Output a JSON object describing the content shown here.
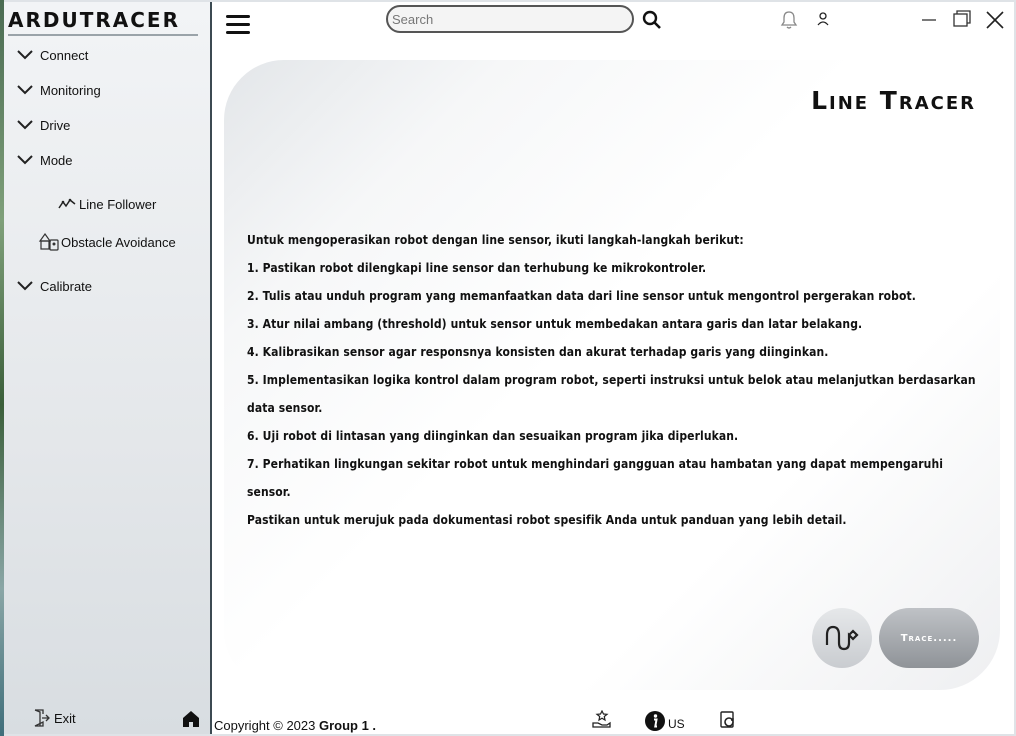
{
  "app": {
    "logo_text": "ArduTracer"
  },
  "sidebar": {
    "items": [
      {
        "label": "Connect"
      },
      {
        "label": "Monitoring"
      },
      {
        "label": "Drive"
      },
      {
        "label": "Mode"
      },
      {
        "label": "Line Follower"
      },
      {
        "label": "Obstacle Avoidance"
      },
      {
        "label": "Calibrate"
      }
    ],
    "exit_label": "Exit"
  },
  "topbar": {
    "search_placeholder": "Search"
  },
  "main": {
    "title": "Line Tracer",
    "paragraphs": [
      "Untuk mengoperasikan robot dengan line sensor, ikuti langkah-langkah berikut:",
      "1. Pastikan robot dilengkapi line sensor dan terhubung ke mikrokontroler.",
      "2. Tulis atau unduh program yang memanfaatkan data dari line sensor untuk mengontrol pergerakan robot.",
      "3. Atur nilai ambang (threshold) untuk sensor untuk membedakan antara garis dan latar belakang.",
      "4. Kalibrasikan sensor agar responsnya konsisten dan akurat terhadap garis yang diinginkan.",
      "5. Implementasikan logika kontrol dalam program robot, seperti instruksi untuk belok atau melanjutkan berdasarkan data sensor.",
      "6. Uji robot di lintasan yang diinginkan dan sesuaikan program jika diperlukan.",
      "7. Perhatikan lingkungan sekitar robot untuk menghindari gangguan atau hambatan yang dapat mempengaruhi sensor.",
      "Pastikan untuk merujuk pada dokumentasi robot spesifik Anda untuk panduan yang lebih detail."
    ],
    "trace_button": "Trace....."
  },
  "footer": {
    "copyright_prefix": "Copyright © 2023 ",
    "copyright_group": "Group 1 .",
    "us_label": "US"
  },
  "colors": {
    "sidebar_border": "#3c4a52",
    "trace_button": "#a3a7ab"
  }
}
